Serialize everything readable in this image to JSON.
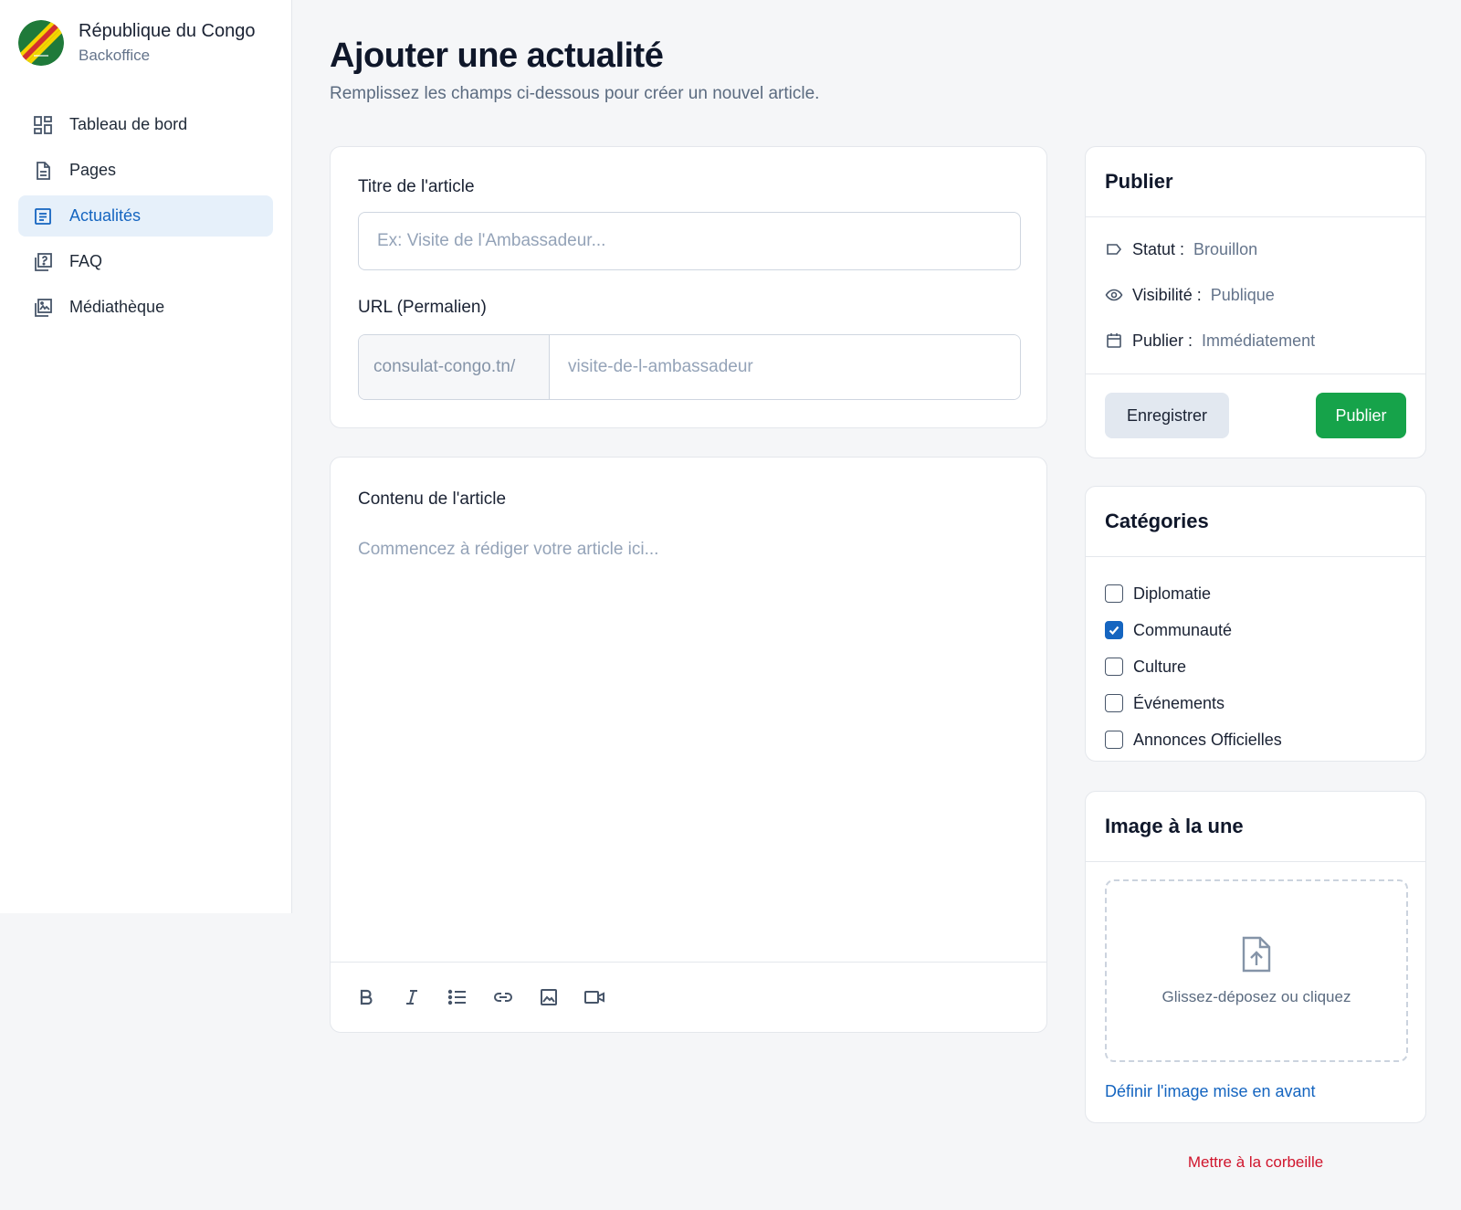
{
  "brand": {
    "title": "République du Congo",
    "subtitle": "Backoffice"
  },
  "sidebar": {
    "items": [
      {
        "label": "Tableau de bord",
        "icon": "dashboard-icon",
        "active": false
      },
      {
        "label": "Pages",
        "icon": "file-icon",
        "active": false
      },
      {
        "label": "Actualités",
        "icon": "news-icon",
        "active": true
      },
      {
        "label": "FAQ",
        "icon": "help-icon",
        "active": false
      },
      {
        "label": "Médiathèque",
        "icon": "media-icon",
        "active": false
      }
    ]
  },
  "header": {
    "title": "Ajouter une actualité",
    "subtitle": "Remplissez les champs ci-dessous pour créer un nouvel article."
  },
  "form": {
    "title_label": "Titre de l'article",
    "title_placeholder": "Ex: Visite de l'Ambassadeur...",
    "title_value": "",
    "url_label": "URL (Permalien)",
    "url_prefix": "consulat-congo.tn/",
    "url_placeholder": "visite-de-l-ambassadeur",
    "url_value": "",
    "content_label": "Contenu de l'article",
    "content_placeholder": "Commencez à rédiger votre article ici...",
    "content_value": "",
    "toolbar": [
      "bold-icon",
      "italic-icon",
      "list-icon",
      "link-icon",
      "image-icon",
      "video-icon"
    ]
  },
  "publish": {
    "heading": "Publier",
    "status_label": "Statut :",
    "status_value": "Brouillon",
    "visibility_label": "Visibilité :",
    "visibility_value": "Publique",
    "publish_label": "Publier :",
    "publish_value": "Immédiatement",
    "save_button": "Enregistrer",
    "publish_button": "Publier"
  },
  "categories": {
    "heading": "Catégories",
    "items": [
      {
        "label": "Diplomatie",
        "checked": false
      },
      {
        "label": "Communauté",
        "checked": true
      },
      {
        "label": "Culture",
        "checked": false
      },
      {
        "label": "Événements",
        "checked": false
      },
      {
        "label": "Annonces Officielles",
        "checked": false
      }
    ]
  },
  "featured_image": {
    "heading": "Image à la une",
    "drop_text": "Glissez-déposez ou cliquez",
    "link": "Définir l'image mise en avant"
  },
  "trash_link": "Mettre à la corbeille",
  "colors": {
    "accent": "#1565c0",
    "active_bg": "#e6f0fa",
    "publish_green": "#16a34a",
    "danger": "#d0142c"
  }
}
